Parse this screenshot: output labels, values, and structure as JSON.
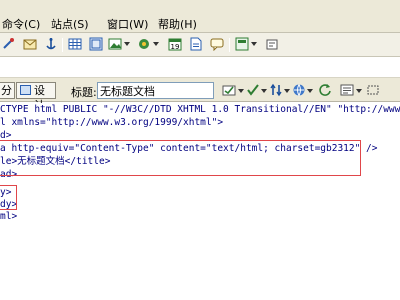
{
  "menu": [
    "命令(C)",
    "站点(S)",
    "窗口(W)",
    "帮助(H)"
  ],
  "docbar": {
    "view_code_partial": "分",
    "view_design": "设计",
    "title_label": "标题:",
    "title_value": "无标题文档"
  },
  "code_lines": [
    "CTYPE html PUBLIC \"-//W3C//DTD XHTML 1.0 Transitional//EN\" \"http://www.w3.",
    "l xmlns=\"http://www.w3.org/1999/xhtml\">",
    "d>",
    "a http-equiv=\"Content-Type\" content=\"text/html; charset=gb2312\" />",
    "le>无标题文档</title>",
    "ad>",
    "",
    "y>",
    "dy>",
    "ml>"
  ],
  "colors": {
    "highlight_box": "#e0464a",
    "toolbar_bg": "#ece9d8"
  }
}
